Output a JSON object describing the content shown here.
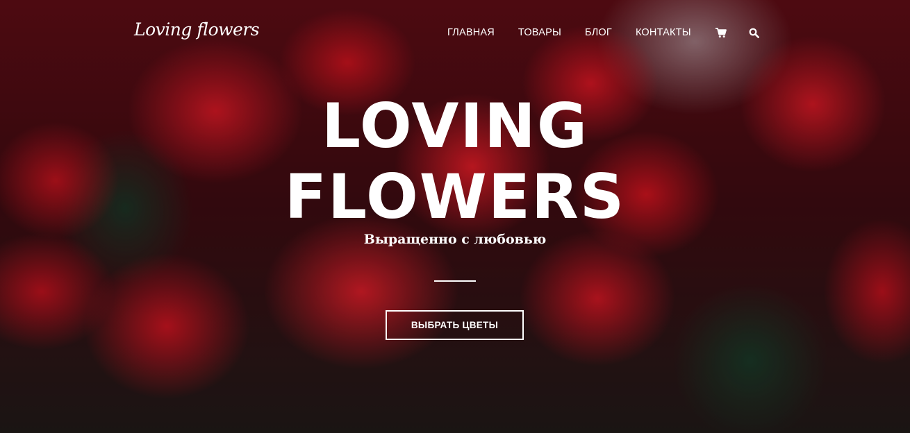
{
  "site": {
    "logo_text": "Loving flowers"
  },
  "nav": {
    "items": [
      {
        "label": "ГЛАВНАЯ"
      },
      {
        "label": "ТОВАРЫ"
      },
      {
        "label": "БЛОГ"
      },
      {
        "label": "КОНТАКТЫ"
      }
    ],
    "icons": {
      "cart": "cart-icon",
      "search": "search-icon"
    }
  },
  "hero": {
    "title_line_1": "LOVING",
    "title_line_2": "FLOWERS",
    "subtitle": "Выращенно с любовью",
    "cta_label": "ВЫБРАТЬ ЦВЕТЫ"
  },
  "colors": {
    "text": "#ffffff",
    "accent_red": "#d6182a"
  }
}
